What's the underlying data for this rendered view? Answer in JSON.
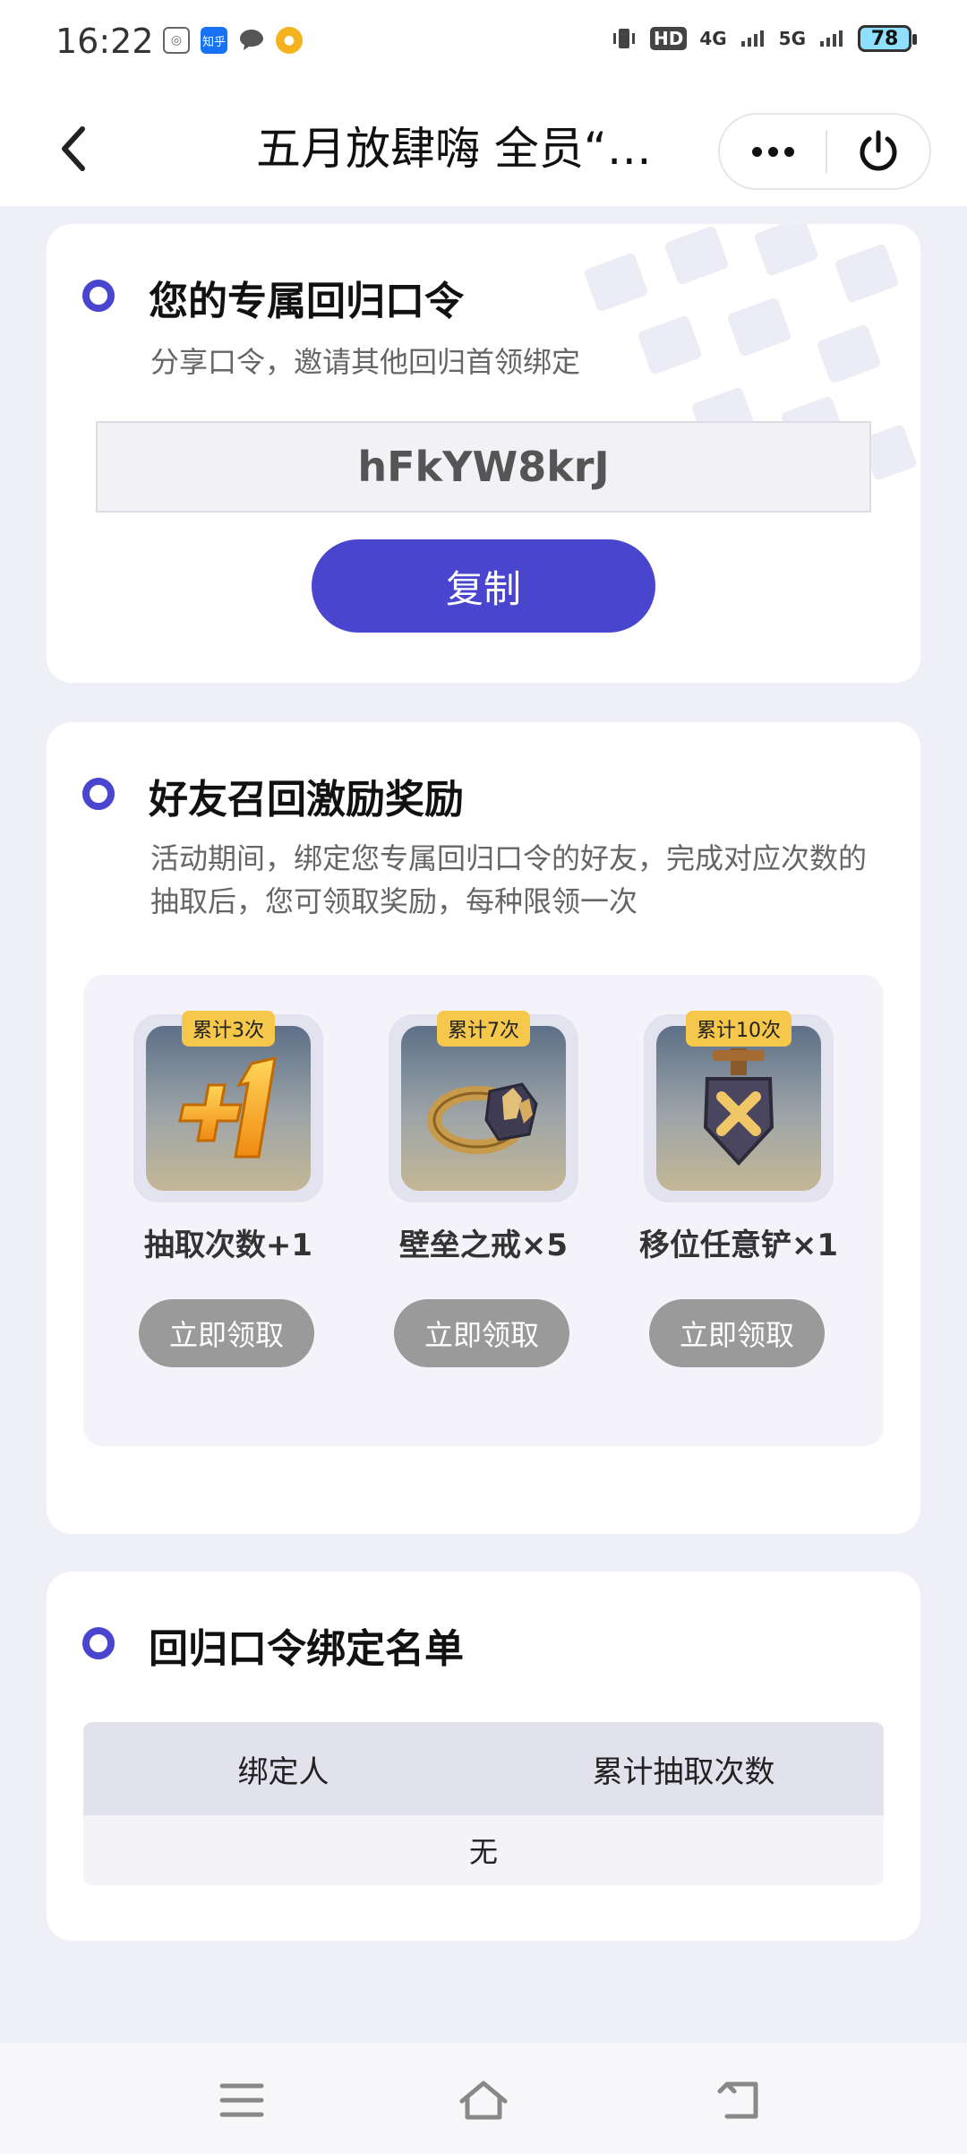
{
  "status_bar": {
    "time": "16:22",
    "battery": "78",
    "signal_labels": [
      "HD",
      "4G",
      "5G"
    ],
    "app_icons": [
      "wechat-icon",
      "zhihu-icon",
      "chat-bubble-icon",
      "game-icon"
    ],
    "zhihu_label": "知乎"
  },
  "nav": {
    "title": "五月放肆嗨 全员“…"
  },
  "code_section": {
    "title": "您的专属回归口令",
    "description": "分享口令，邀请其他回归首领绑定",
    "code": "hFkYW8krJ",
    "copy_label": "复制"
  },
  "reward_section": {
    "title": "好友召回激励奖励",
    "description": "活动期间，绑定您专属回归口令的好友，完成对应次数的抽取后，您可领取奖励，每种限领一次",
    "items": [
      {
        "badge": "累计3次",
        "name": "抽取次数+1",
        "button": "立即领取",
        "icon": "plus-one-icon"
      },
      {
        "badge": "累计7次",
        "name": "壁垒之戒×5",
        "button": "立即领取",
        "icon": "ring-icon"
      },
      {
        "badge": "累计10次",
        "name": "移位任意铲×1",
        "button": "立即领取",
        "icon": "shovel-icon"
      }
    ]
  },
  "bind_section": {
    "title": "回归口令绑定名单",
    "col_binder": "绑定人",
    "col_count": "累计抽取次数",
    "empty": "无"
  },
  "colors": {
    "accent": "#4a45cf",
    "background": "#efeff8",
    "disabled_button": "#9a9a9a",
    "badge": "#f5c84b"
  }
}
